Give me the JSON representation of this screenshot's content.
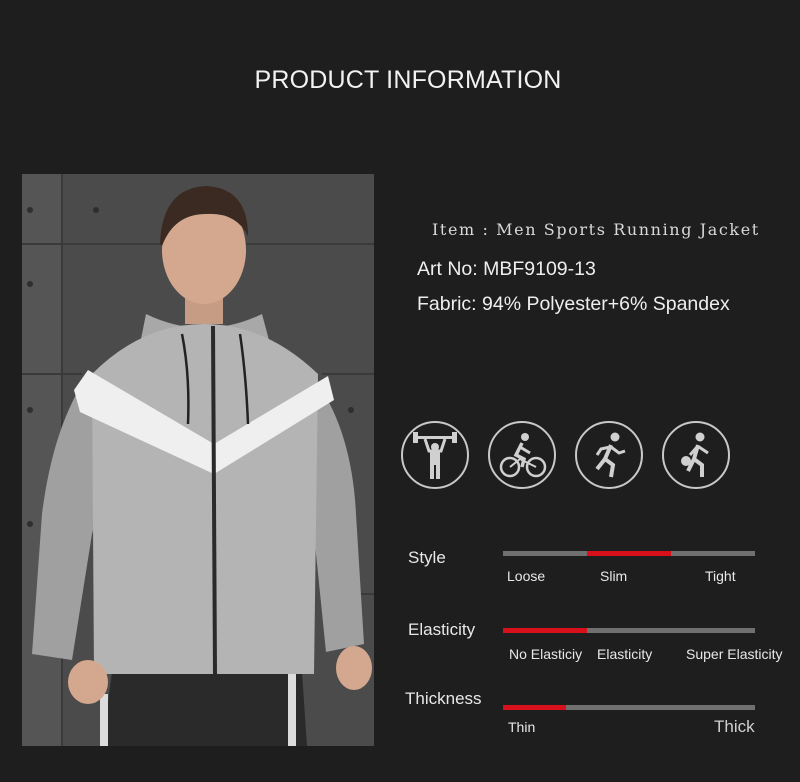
{
  "page": {
    "title": "PRODUCT INFORMATION"
  },
  "product": {
    "item": "Item : Men Sports Running Jacket",
    "art_no": "Art No: MBF9109-13",
    "fabric": "Fabric: 94% Polyester+6% Spandex",
    "photo": "model-wearing-jacket-photo"
  },
  "sports_icons": [
    "weightlifting-icon",
    "cycling-icon",
    "running-icon",
    "basketball-icon"
  ],
  "ratings": [
    {
      "label": "Style",
      "ticks": [
        "Loose",
        "Slim",
        "Tight"
      ],
      "selected_index": 1,
      "tick_count": 3
    },
    {
      "label": "Elasticity",
      "ticks": [
        "No Elasticiy",
        "Elasticity",
        "Super Elasticity"
      ],
      "selected_index": 0,
      "tick_count": 3
    },
    {
      "label": "Thickness",
      "ticks": [
        "Thin",
        "Thick"
      ],
      "selected_index": 0,
      "tick_count": 4
    }
  ],
  "colors": {
    "background": "#1e1e1e",
    "accent": "#d8101c",
    "track": "#707070"
  }
}
